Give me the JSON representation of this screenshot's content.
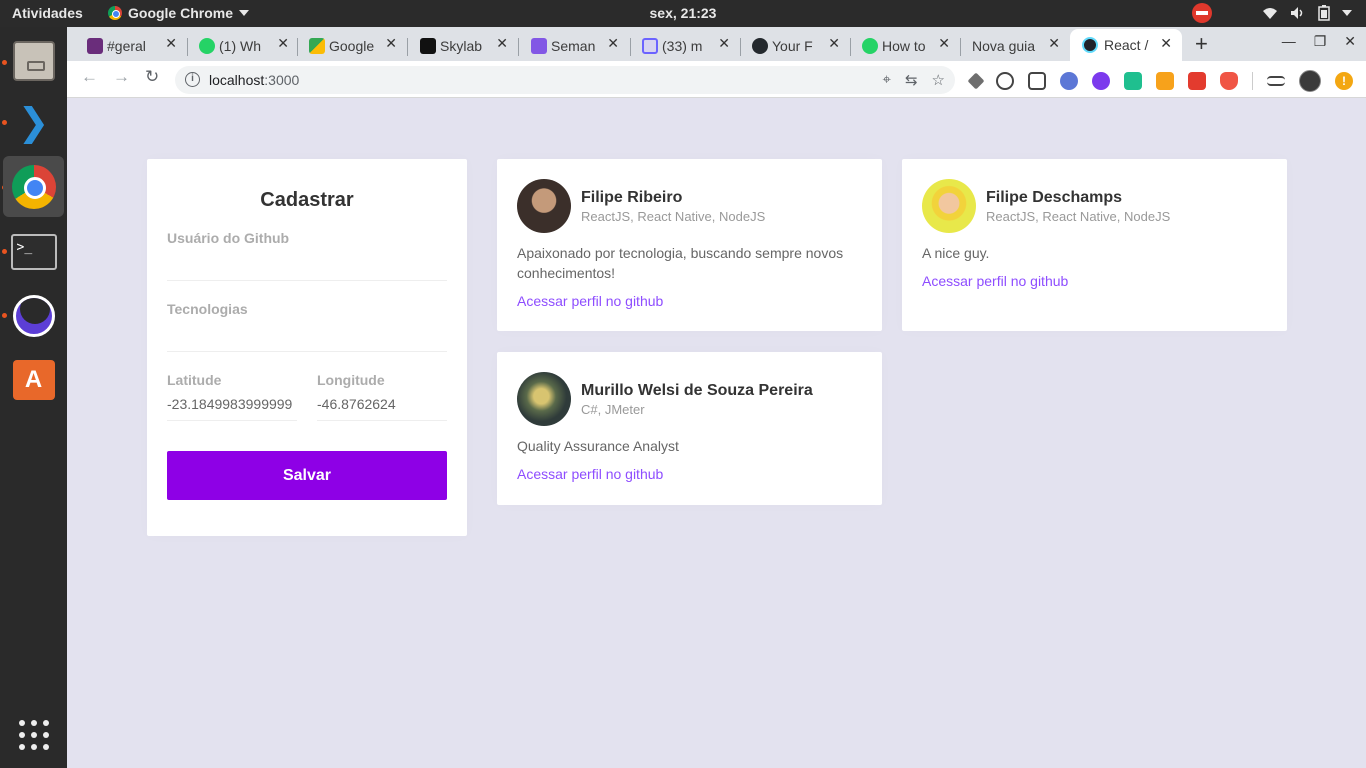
{
  "system": {
    "activities": "Atividades",
    "app_name": "Google Chrome",
    "clock": "sex, 21:23"
  },
  "browser": {
    "tabs": [
      {
        "label": "#geral",
        "favicon": "slack-icon",
        "color": "#6a2d7b"
      },
      {
        "label": "(1) Wh",
        "favicon": "whatsapp-icon",
        "color": "#25d366"
      },
      {
        "label": "Google",
        "favicon": "google-maps-icon",
        "color": "#34a853"
      },
      {
        "label": "Skylab",
        "favicon": "skylab-icon",
        "color": "#111111"
      },
      {
        "label": "Seman",
        "favicon": "rocketseat-icon",
        "color": "#8257e5"
      },
      {
        "label": "(33) m",
        "favicon": "shield-icon",
        "color": "#6c63ff"
      },
      {
        "label": "Your F",
        "favicon": "github-icon",
        "color": "#24292e"
      },
      {
        "label": "How to",
        "favicon": "whatsapp-icon",
        "color": "#25d366"
      },
      {
        "label": "Nova guia",
        "favicon": "",
        "color": ""
      },
      {
        "label": "React /",
        "favicon": "react-icon",
        "color": "#61dafb"
      }
    ],
    "new_tab": "+",
    "url_host": "localhost",
    "url_port": ":3000"
  },
  "form": {
    "title": "Cadastrar",
    "github_label": "Usuário do Github",
    "github_value": "",
    "techs_label": "Tecnologias",
    "techs_value": "",
    "latitude_label": "Latitude",
    "latitude_value": "-23.1849983999999",
    "longitude_label": "Longitude",
    "longitude_value": "-46.8762624",
    "save_label": "Salvar"
  },
  "devs": [
    {
      "name": "Filipe Ribeiro",
      "techs": "ReactJS, React Native, NodeJS",
      "bio": "Apaixonado por tecnologia, buscando sempre novos conhecimentos!",
      "link": "Acessar perfil no github"
    },
    {
      "name": "Filipe Deschamps",
      "techs": "ReactJS, React Native, NodeJS",
      "bio": "A nice guy.",
      "link": "Acessar perfil no github"
    },
    {
      "name": "Murillo Welsi de Souza Pereira",
      "techs": "C#, JMeter",
      "bio": "Quality Assurance Analyst",
      "link": "Acessar perfil no github"
    }
  ],
  "colors": {
    "accent": "#8e00e6",
    "link": "#8e4dff",
    "background": "#e3e2ef"
  }
}
